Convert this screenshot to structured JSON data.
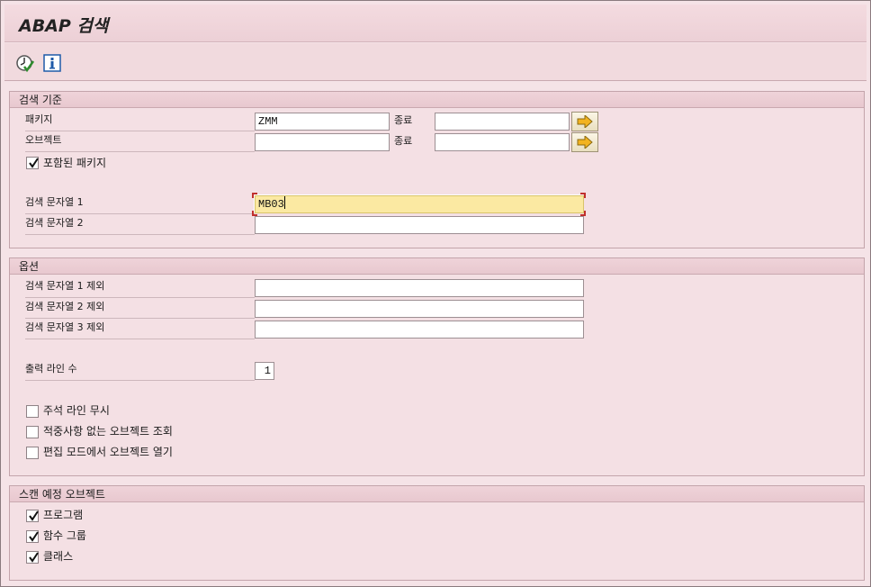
{
  "app": {
    "title": "ABAP 검색"
  },
  "toolbar": {
    "execute_icon": "execute-clock-check-icon",
    "info_icon": "info-icon"
  },
  "criteria": {
    "heading": "검색 기준",
    "package_label": "패키지",
    "package_value": "ZMM",
    "package_to_label": "종료",
    "package_to_value": "",
    "object_label": "오브젝트",
    "object_value": "",
    "object_to_label": "종료",
    "object_to_value": "",
    "incl_packages_label": "포함된 패키지",
    "incl_packages_checked": true,
    "search_string1_label": "검색 문자열 1",
    "search_string1_value": "MB03",
    "search_string2_label": "검색 문자열 2",
    "search_string2_value": ""
  },
  "options": {
    "heading": "옵션",
    "exclude1_label": "검색 문자열 1 제외",
    "exclude1_value": "",
    "exclude2_label": "검색 문자열 2 제외",
    "exclude2_value": "",
    "exclude3_label": "검색 문자열 3 제외",
    "exclude3_value": "",
    "output_lines_label": "출력 라인 수",
    "output_lines_value": "1",
    "ignore_comments_label": "주석 라인 무시",
    "ignore_comments_checked": false,
    "no_hits_label": "적중사항 없는 오브젝트 조회",
    "no_hits_checked": false,
    "edit_mode_label": "편집 모드에서 오브젝트 열기",
    "edit_mode_checked": false
  },
  "scan": {
    "heading": "스캔 예정 오브젝트",
    "programs_label": "프로그램",
    "programs_checked": true,
    "function_groups_label": "함수 그룹",
    "function_groups_checked": true,
    "classes_label": "클래스",
    "classes_checked": true
  },
  "colors": {
    "background": "#f5e3e7",
    "active_field": "#fbe9a2",
    "focus_corner": "#c0302c"
  }
}
